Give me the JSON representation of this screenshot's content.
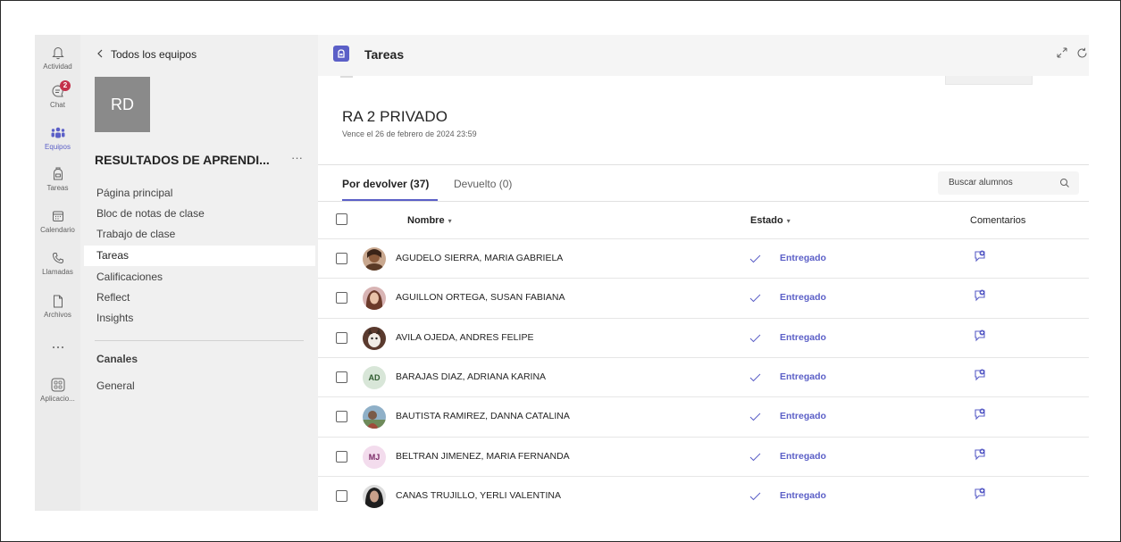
{
  "rail": [
    {
      "label": "Actividad",
      "icon": "bell-icon"
    },
    {
      "label": "Chat",
      "icon": "chat-icon",
      "badge": "2"
    },
    {
      "label": "Equipos",
      "icon": "teams-icon",
      "active": true
    },
    {
      "label": "Tareas",
      "icon": "backpack-icon"
    },
    {
      "label": "Calendario",
      "icon": "calendar-icon"
    },
    {
      "label": "Llamadas",
      "icon": "phone-icon"
    },
    {
      "label": "Archivos",
      "icon": "file-icon"
    },
    {
      "label": "",
      "icon": "more-icon"
    },
    {
      "label": "Aplicacio...",
      "icon": "apps-icon"
    }
  ],
  "team": {
    "back_label": "Todos los equipos",
    "initials": "RD",
    "name": "RESULTADOS DE APRENDI...",
    "more": "···",
    "nav": [
      "Página principal",
      "Bloc de notas de clase",
      "Trabajo de clase",
      "Tareas",
      "Calificaciones",
      "Reflect",
      "Insights"
    ],
    "active_nav": "Tareas",
    "channels_heading": "Canales",
    "channels": [
      "General"
    ]
  },
  "main": {
    "app_title": "Tareas",
    "assignment": {
      "title": "RA 2 PRIVADO",
      "due": "Vence el 26 de febrero de 2024 23:59"
    },
    "tabs": [
      {
        "label": "Por devolver (37)",
        "active": true
      },
      {
        "label": "Devuelto (0)",
        "active": false
      }
    ],
    "search_placeholder": "Buscar alumnos",
    "columns": {
      "name": "Nombre",
      "status": "Estado",
      "feedback": "Comentarios",
      "sort_glyph": "▾"
    },
    "students": [
      {
        "name": "AGUDELO SIERRA, MARIA GABRIELA",
        "status": "Entregado",
        "avatar": "photo",
        "photo": "warm"
      },
      {
        "name": "AGUILLON ORTEGA, SUSAN FABIANA",
        "status": "Entregado",
        "avatar": "photo",
        "photo": "pink"
      },
      {
        "name": "AVILA OJEDA, ANDRES FELIPE",
        "status": "Entregado",
        "avatar": "photo",
        "photo": "pet"
      },
      {
        "name": "BARAJAS DIAZ, ADRIANA KARINA",
        "status": "Entregado",
        "avatar": "initials",
        "initials": "AD",
        "bg": "#d8e6d8",
        "fg": "#2e5a2e"
      },
      {
        "name": "BAUTISTA RAMIREZ, DANNA CATALINA",
        "status": "Entregado",
        "avatar": "photo",
        "photo": "outdoor"
      },
      {
        "name": "BELTRAN JIMENEZ, MARIA FERNANDA",
        "status": "Entregado",
        "avatar": "initials",
        "initials": "MJ",
        "bg": "#f3dced",
        "fg": "#7a2a66"
      },
      {
        "name": "CANAS TRUJILLO, YERLI VALENTINA",
        "status": "Entregado",
        "avatar": "photo",
        "photo": "dark"
      }
    ]
  },
  "colors": {
    "accent": "#5b5fc7",
    "rail_bg": "#ebebeb",
    "pane_bg": "#f0f0f0",
    "badge": "#c4314b"
  }
}
